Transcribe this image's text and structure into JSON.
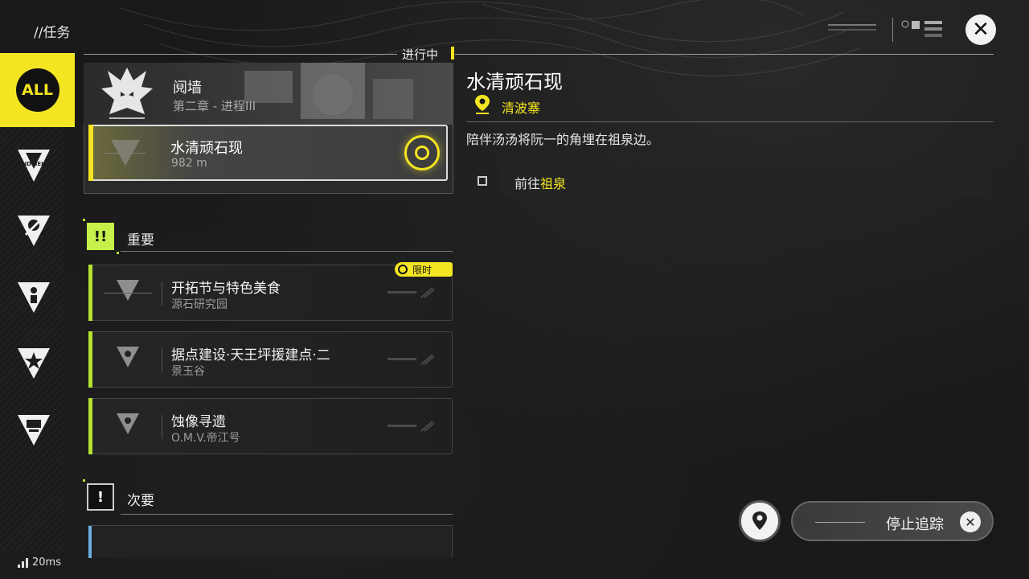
{
  "header": {
    "title": "//任务"
  },
  "tracking": {
    "label": "进行中"
  },
  "chapter": {
    "name": "阋墙",
    "subtitle": "第二章 - 进程III"
  },
  "tracked_quest": {
    "name": "水清顽石现",
    "distance": "982 m"
  },
  "sections": {
    "important": {
      "label": "重要",
      "icon": "!!"
    },
    "secondary": {
      "label": "次要",
      "icon": "!"
    }
  },
  "important_quests": [
    {
      "name": "开拓节与特色美食",
      "location": "源石研究园",
      "badge": "限时"
    },
    {
      "name": "据点建设·天王坪援建点·二",
      "location": "景玉谷"
    },
    {
      "name": "蚀像寻遗",
      "location": "O.M.V.帝江号"
    }
  ],
  "detail": {
    "title": "水清顽石现",
    "location": "清波寨",
    "description": "陪伴汤汤将阮一的角埋在祖泉边。",
    "objective_prefix": "前往",
    "objective_highlight": "祖泉"
  },
  "actions": {
    "stop_tracking": "停止追踪"
  },
  "rail": {
    "all_label": "ALL",
    "endfield_label": "ENDFIELD"
  },
  "status": {
    "ping": "20ms"
  },
  "colors": {
    "accent_yellow": "#f4e522",
    "accent_green": "#b5e332"
  }
}
